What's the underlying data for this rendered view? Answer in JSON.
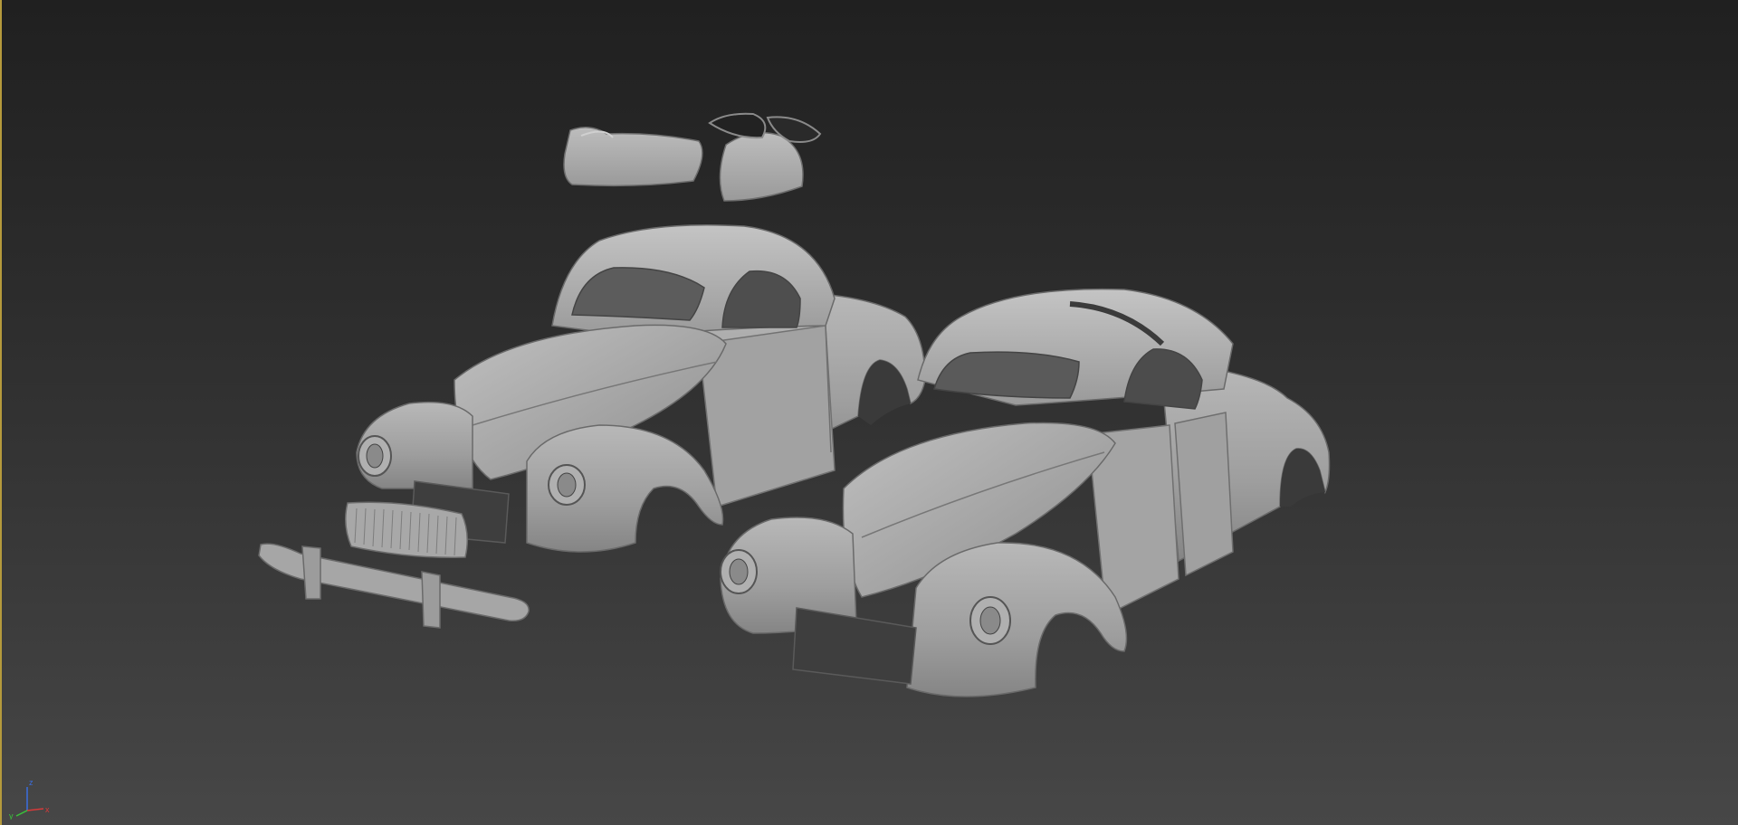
{
  "viewport": {
    "background_top": "#202020",
    "background_bottom": "#474747",
    "active_border_color": "#b59a3c"
  },
  "scene": {
    "objects": [
      "windshield-left-glass",
      "windshield-right-glass",
      "rear-glass-pieces",
      "car-body-assembled",
      "car-body-exploded-doors",
      "front-grille",
      "front-bumper"
    ]
  },
  "axis_gizmo": {
    "x_label": "x",
    "y_label": "y",
    "z_label": "z",
    "x_color": "#d63a3a",
    "y_color": "#3ac43a",
    "z_color": "#3a6ee0"
  }
}
